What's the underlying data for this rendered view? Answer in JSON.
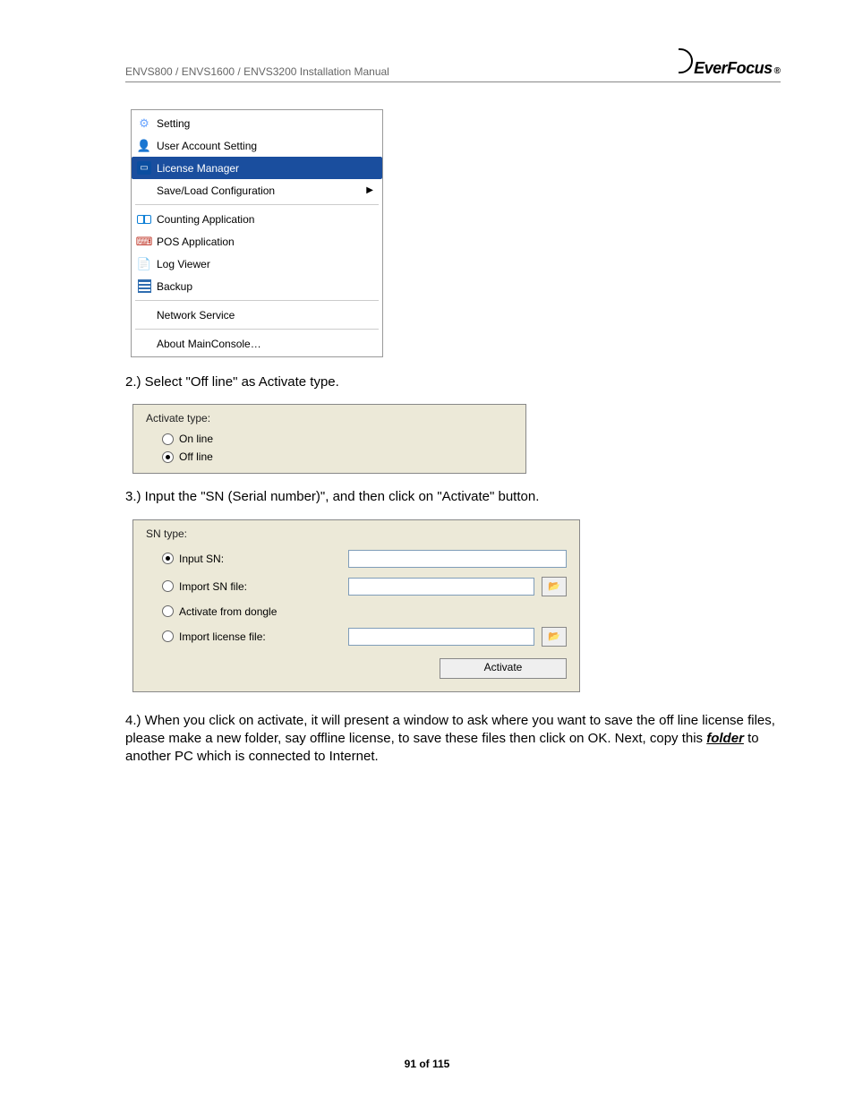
{
  "header": {
    "title": "ENVS800 / ENVS1600 / ENVS3200 Installation Manual",
    "brand": "EverFocus",
    "reg": "®"
  },
  "menu": {
    "items": [
      {
        "label": "Setting",
        "icon": "gear"
      },
      {
        "label": "User Account Setting",
        "icon": "user"
      },
      {
        "label": "License Manager",
        "icon": "card",
        "selected": true
      },
      {
        "label": "Save/Load Configuration",
        "icon": "",
        "submenu": true
      }
    ],
    "group2": [
      {
        "label": "Counting Application",
        "icon": "counting"
      },
      {
        "label": "POS Application",
        "icon": "pos"
      },
      {
        "label": "Log Viewer",
        "icon": "log"
      },
      {
        "label": "Backup",
        "icon": "backup"
      }
    ],
    "group3": [
      {
        "label": "Network Service"
      }
    ],
    "group4": [
      {
        "label": "About MainConsole…"
      }
    ]
  },
  "step2": {
    "text": "2.) Select \"Off line\" as Activate type.",
    "panel": {
      "title": "Activate type:",
      "online": "On line",
      "offline": "Off line"
    }
  },
  "step3": {
    "text": "3.) Input the \"SN (Serial number)\", and then click on \"Activate\" button.",
    "panel": {
      "title": "SN type:",
      "input_sn": "Input SN:",
      "import_sn": "Import SN file:",
      "from_dongle": "Activate from dongle",
      "import_lic": "Import license file:",
      "activate_btn": "Activate"
    }
  },
  "step4": {
    "pre": "4.) When you click on activate, it will present a window to ask where you want to save the off line license files, please make a new folder, say offline license, to save these files then click on OK. Next, copy this ",
    "folder": "folder",
    "post": " to another PC which is connected to Internet."
  },
  "footer": {
    "page": "91 of 115"
  }
}
